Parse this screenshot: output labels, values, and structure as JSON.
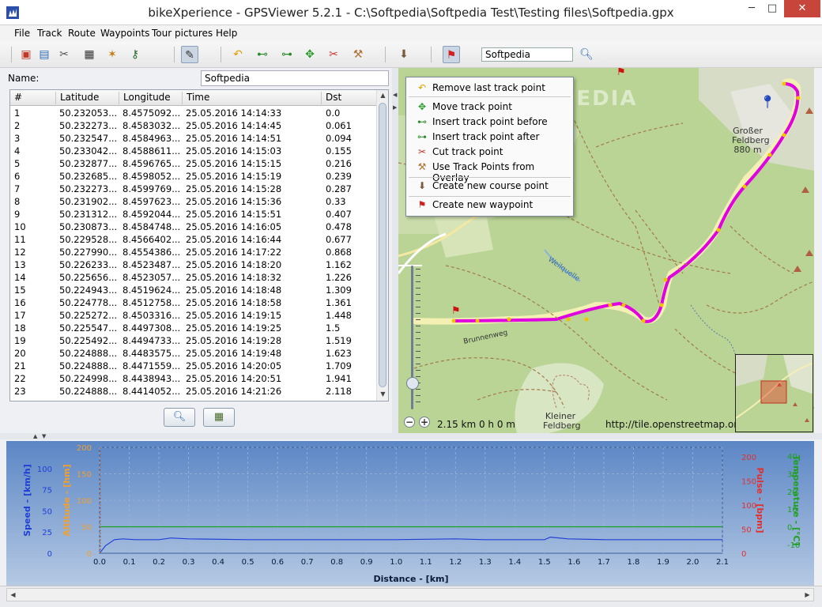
{
  "window": {
    "title": "bikeXperience - GPSViewer 5.2.1 - C:\\Softpedia\\Softpedia Test\\Testing files\\Softpedia.gpx",
    "controls": [
      "─",
      "□",
      "✕"
    ]
  },
  "menu": [
    "File",
    "Track",
    "Route",
    "Waypoints",
    "Tour pictures",
    "Help"
  ],
  "toolbar": {
    "search_value": "Softpedia"
  },
  "track": {
    "name_label": "Name:",
    "name_value": "Softpedia",
    "columns": [
      "#",
      "Latitude",
      "Longitude",
      "Time",
      "Dst"
    ],
    "rows": [
      [
        "1",
        "50.232053...",
        "8.4575092...",
        "25.05.2016 14:14:33",
        "0.0"
      ],
      [
        "2",
        "50.232273...",
        "8.4583032...",
        "25.05.2016 14:14:45",
        "0.061"
      ],
      [
        "3",
        "50.232547...",
        "8.4584963...",
        "25.05.2016 14:14:51",
        "0.094"
      ],
      [
        "4",
        "50.233042...",
        "8.4588611...",
        "25.05.2016 14:15:03",
        "0.155"
      ],
      [
        "5",
        "50.232877...",
        "8.4596765...",
        "25.05.2016 14:15:15",
        "0.216"
      ],
      [
        "6",
        "50.232685...",
        "8.4598052...",
        "25.05.2016 14:15:19",
        "0.239"
      ],
      [
        "7",
        "50.232273...",
        "8.4599769...",
        "25.05.2016 14:15:28",
        "0.287"
      ],
      [
        "8",
        "50.231902...",
        "8.4597623...",
        "25.05.2016 14:15:36",
        "0.33"
      ],
      [
        "9",
        "50.231312...",
        "8.4592044...",
        "25.05.2016 14:15:51",
        "0.407"
      ],
      [
        "10",
        "50.230873...",
        "8.4584748...",
        "25.05.2016 14:16:05",
        "0.478"
      ],
      [
        "11",
        "50.229528...",
        "8.4566402...",
        "25.05.2016 14:16:44",
        "0.677"
      ],
      [
        "12",
        "50.227990...",
        "8.4554386...",
        "25.05.2016 14:17:22",
        "0.868"
      ],
      [
        "13",
        "50.226233...",
        "8.4523487...",
        "25.05.2016 14:18:20",
        "1.162"
      ],
      [
        "14",
        "50.225656...",
        "8.4523057...",
        "25.05.2016 14:18:32",
        "1.226"
      ],
      [
        "15",
        "50.224943...",
        "8.4519624...",
        "25.05.2016 14:18:48",
        "1.309"
      ],
      [
        "16",
        "50.224778...",
        "8.4512758...",
        "25.05.2016 14:18:58",
        "1.361"
      ],
      [
        "17",
        "50.225272...",
        "8.4503316...",
        "25.05.2016 14:19:15",
        "1.448"
      ],
      [
        "18",
        "50.225547...",
        "8.4497308...",
        "25.05.2016 14:19:25",
        "1.5"
      ],
      [
        "19",
        "50.225492...",
        "8.4494733...",
        "25.05.2016 14:19:28",
        "1.519"
      ],
      [
        "20",
        "50.224888...",
        "8.4483575...",
        "25.05.2016 14:19:48",
        "1.623"
      ],
      [
        "21",
        "50.224888...",
        "8.4471559...",
        "25.05.2016 14:20:05",
        "1.709"
      ],
      [
        "22",
        "50.224998...",
        "8.4438943...",
        "25.05.2016 14:20:51",
        "1.941"
      ],
      [
        "23",
        "50.224888...",
        "8.4414052...",
        "25.05.2016 14:21:26",
        "2.118"
      ]
    ]
  },
  "context_menu": {
    "items": [
      {
        "label": "Remove last track point",
        "icon": "undo-arrow-icon"
      },
      {
        "label": "Move track point",
        "icon": "move-arrows-icon"
      },
      {
        "label": "Insert track point before",
        "icon": "insert-before-icon"
      },
      {
        "label": "Insert track point after",
        "icon": "insert-after-icon"
      },
      {
        "label": "Cut track point",
        "icon": "scissors-icon"
      },
      {
        "label": "Use Track Points from Overlay",
        "icon": "wand-icon"
      },
      {
        "label": "Create new course point",
        "icon": "course-point-icon"
      },
      {
        "label": "Create new waypoint",
        "icon": "flag-icon"
      }
    ]
  },
  "map": {
    "labels": {
      "peak_grosser": "Großer",
      "peak_grosser_2": "Feldberg",
      "peak_grosser_alt": "880 m",
      "peak_kleiner": "Kleiner",
      "peak_kleiner_2": "Feldberg",
      "brunnenweg": "Brunnenweg",
      "weilquelle": "Weilquelle",
      "watermark": "SOFTPEDIA"
    },
    "scale_text": "2.15 km 0 h 0 m",
    "credit": "http://tile.openstreetmap.org",
    "zoom_level": 0.82,
    "colors": {
      "track": "#e000e0",
      "forest": "#add19e",
      "road": "#f7f5c0"
    }
  },
  "chart_data": {
    "type": "line",
    "xlabel": "Distance - [km]",
    "xlim": [
      0.0,
      2.1
    ],
    "xticks": [
      "0.0",
      "0.1",
      "0.2",
      "0.3",
      "0.4",
      "0.5",
      "0.6",
      "0.7",
      "0.8",
      "0.9",
      "1.0",
      "1.1",
      "1.2",
      "1.3",
      "1.4",
      "1.5",
      "1.6",
      "1.7",
      "1.8",
      "1.9",
      "2.0",
      "2.1"
    ],
    "axes": [
      {
        "name": "Speed - [km/h]",
        "color": "#1f3fd6",
        "ticks": [
          "0",
          "25",
          "50",
          "75",
          "100"
        ],
        "range": [
          0,
          125
        ]
      },
      {
        "name": "Altitude - [hm]",
        "color": "#f0a030",
        "ticks": [
          "0",
          "50",
          "100",
          "150",
          "200"
        ],
        "range": [
          0,
          200
        ]
      },
      {
        "name": "Pulse - [bpm]",
        "color": "#e03030",
        "ticks": [
          "0",
          "50",
          "100",
          "150",
          "200"
        ],
        "range": [
          0,
          220
        ]
      },
      {
        "name": "Temperature - [°C]",
        "color": "#20a020",
        "ticks": [
          "-10",
          "0",
          "10",
          "20",
          "30",
          "40"
        ],
        "range": [
          -15,
          45
        ]
      }
    ],
    "series": [
      {
        "name": "Speed - [km/h]",
        "color": "#1f3fd6",
        "x": [
          0.0,
          0.02,
          0.05,
          0.08,
          0.12,
          0.16,
          0.2,
          0.22,
          0.24,
          0.3,
          0.5,
          0.8,
          1.0,
          1.2,
          1.3,
          1.45,
          1.5,
          1.52,
          1.58,
          1.7,
          2.0,
          2.1
        ],
        "y": [
          0,
          9,
          16,
          17,
          16,
          16,
          16,
          17,
          18,
          17,
          16,
          16,
          16,
          17,
          16,
          16,
          16,
          19,
          17,
          16,
          16,
          16
        ]
      },
      {
        "name": "Temperature - [°C]",
        "color": "#20a020",
        "x": [
          0.0,
          2.1
        ],
        "y": [
          0,
          0
        ]
      }
    ]
  },
  "footer": {
    "left_arrow": "◀",
    "right_arrow": "▶"
  }
}
